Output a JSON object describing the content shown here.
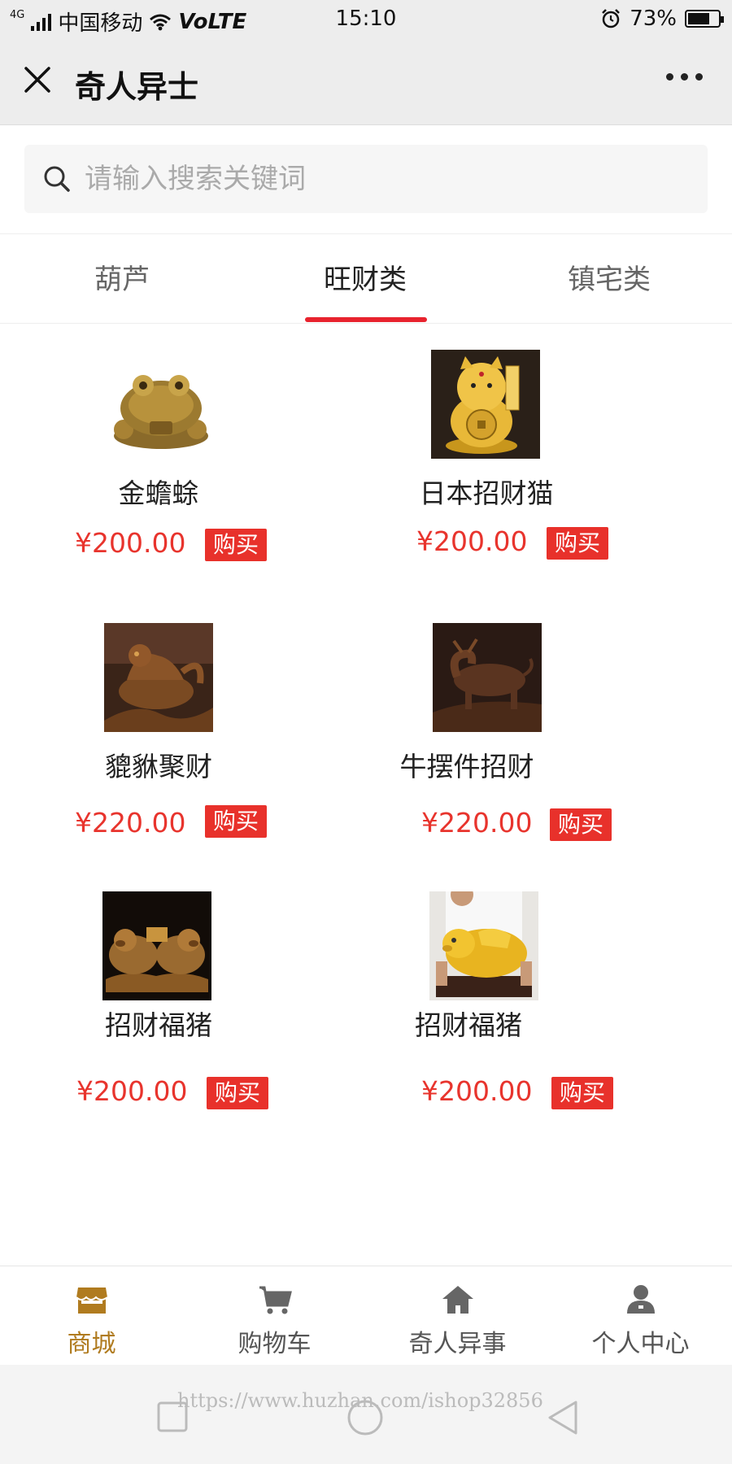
{
  "status": {
    "network": "4G",
    "carrier": "中国移动",
    "volte": "VoLTE",
    "time": "15:10",
    "battery": "73%",
    "battery_level": 0.73
  },
  "header": {
    "title": "奇人异士"
  },
  "search": {
    "placeholder": "请输入搜索关键词"
  },
  "tabs": [
    {
      "label": "葫芦"
    },
    {
      "label": "旺财类"
    },
    {
      "label": "镇宅类"
    }
  ],
  "buy_label": "购买",
  "products": [
    {
      "name": "金蟾蜍",
      "price": "¥200.00"
    },
    {
      "name": "日本招财猫",
      "price": "¥200.00"
    },
    {
      "name": "貔貅聚财",
      "price": "¥220.00"
    },
    {
      "name": "牛摆件招财",
      "price": "¥220.00"
    },
    {
      "name": "招财福猪",
      "price": "¥200.00"
    },
    {
      "name": "招财福猪",
      "price": "¥200.00"
    }
  ],
  "tabbar": [
    {
      "label": "商城",
      "icon": "shop-icon"
    },
    {
      "label": "购物车",
      "icon": "cart-icon"
    },
    {
      "label": "奇人异事",
      "icon": "home-icon"
    },
    {
      "label": "个人中心",
      "icon": "user-icon"
    }
  ],
  "watermark": "https://www.huzhan.com/ishop32856",
  "colors": {
    "accent_red": "#e8312b",
    "tab_active": "#b07b1f"
  }
}
